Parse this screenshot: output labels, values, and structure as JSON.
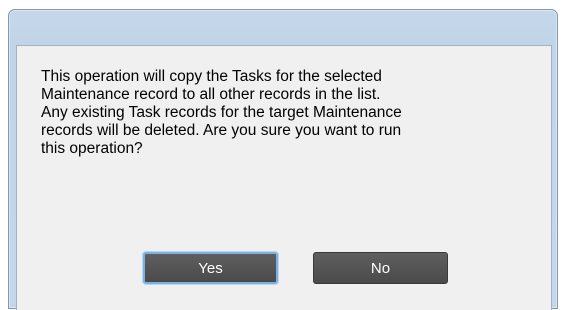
{
  "dialog": {
    "title": "",
    "message": "This operation will copy the Tasks for the selected\nMaintenance record to all other records in the list.\nAny existing Task records for the target Maintenance\nrecords will be deleted.  Are you sure you want to run\nthis operation?",
    "buttons": {
      "yes_label": "Yes",
      "no_label": "No"
    }
  },
  "colors": {
    "frame": "#c3d6ea",
    "client_background": "#f0f0f0",
    "button_background": "#505050",
    "focus_border": "#7ab0e2"
  }
}
